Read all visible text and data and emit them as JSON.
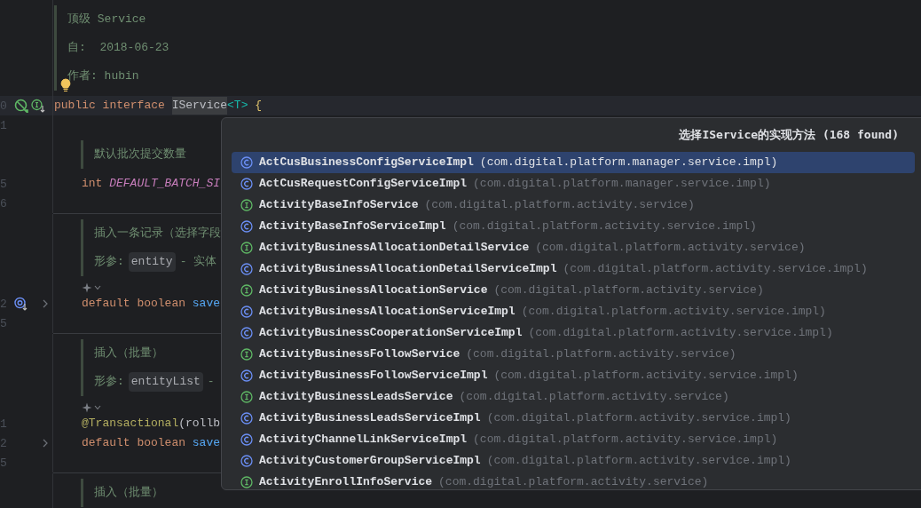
{
  "editor": {
    "rows": [
      {
        "kind": "doc",
        "lines": [
          [
            {
              "kind": "plain",
              "text": "顶级 Service"
            }
          ],
          [
            {
              "kind": "plain",
              "text": "自:  2018-06-23"
            }
          ],
          [
            {
              "kind": "plain",
              "text": "作者: hubin"
            }
          ]
        ],
        "lightbulb": true
      },
      {
        "kind": "code",
        "line_number": "0",
        "current": true,
        "gutter": [
          {
            "kind": "prohibited"
          },
          {
            "kind": "interface-down"
          }
        ],
        "words": [
          [
            {
              "kind": "keyword",
              "text": "public",
              "highlighted": false
            }
          ],
          [
            {
              "kind": "keyword",
              "text": "interface",
              "highlighted": false
            }
          ],
          [
            {
              "kind": "plain",
              "text": "IService",
              "highlighted": true
            },
            {
              "kind": "generic",
              "text": "<T>",
              "highlighted": false
            }
          ],
          [
            {
              "kind": "brace",
              "text": "{",
              "highlighted": false
            }
          ]
        ],
        "children": [
          {
            "kind": "blank",
            "line_number": "1"
          },
          {
            "kind": "doc",
            "lines": [
              [
                {
                  "kind": "plain",
                  "text": "默认批次提交数量"
                }
              ]
            ]
          },
          {
            "kind": "code",
            "line_number": "5",
            "current": false,
            "words": [
              [
                {
                  "kind": "keyword",
                  "text": "int"
                }
              ],
              [
                {
                  "kind": "constant",
                  "text": "DEFAULT_BATCH_SI"
                }
              ]
            ]
          },
          {
            "kind": "blank",
            "line_number": "6"
          },
          {
            "kind": "separator"
          },
          {
            "kind": "doc",
            "lines": [
              [
                {
                  "kind": "plain",
                  "text": "插入一条记录（选择字段"
                }
              ],
              [
                {
                  "kind": "plain",
                  "text": "形参:"
                },
                {
                  "kind": "code",
                  "text": "entity"
                },
                {
                  "kind": "plain",
                  "text": "- 实体"
                }
              ]
            ]
          },
          {
            "kind": "hint"
          },
          {
            "kind": "code",
            "line_number": "2",
            "current": false,
            "gutter": [
              {
                "kind": "override-down"
              },
              {
                "kind": "fold"
              }
            ],
            "words": [
              [
                {
                  "kind": "keyword",
                  "text": "default"
                }
              ],
              [
                {
                  "kind": "keyword",
                  "text": "boolean"
                }
              ],
              [
                {
                  "kind": "method",
                  "text": "save"
                }
              ]
            ]
          },
          {
            "kind": "blank",
            "line_number": "5"
          },
          {
            "kind": "separator"
          },
          {
            "kind": "doc",
            "lines": [
              [
                {
                  "kind": "plain",
                  "text": "插入（批量）"
                }
              ],
              [
                {
                  "kind": "plain",
                  "text": "形参:"
                },
                {
                  "kind": "code",
                  "text": "entityList"
                },
                {
                  "kind": "plain",
                  "text": "-"
                }
              ]
            ]
          },
          {
            "kind": "hint"
          },
          {
            "kind": "code",
            "line_number": "1",
            "current": false,
            "words": [
              [
                {
                  "kind": "annotation",
                  "text": "@Transactional"
                },
                {
                  "kind": "plain",
                  "text": "(rollb"
                }
              ]
            ]
          },
          {
            "kind": "code",
            "line_number": "2",
            "current": false,
            "gutter": [
              {
                "kind": "fold"
              }
            ],
            "words": [
              [
                {
                  "kind": "keyword",
                  "text": "default"
                }
              ],
              [
                {
                  "kind": "keyword",
                  "text": "boolean"
                }
              ],
              [
                {
                  "kind": "method",
                  "text": "save"
                }
              ]
            ]
          },
          {
            "kind": "blank",
            "line_number": "5"
          },
          {
            "kind": "separator"
          },
          {
            "kind": "doc",
            "lines": [
              [
                {
                  "kind": "plain",
                  "text": "插入（批量）"
                }
              ]
            ]
          }
        ]
      }
    ]
  },
  "popup": {
    "title": "选择IService的实现方法 (168 found)",
    "items": [
      {
        "kind": "class",
        "name": "ActCusBusinessConfigServiceImpl",
        "package": "(com.digital.platform.manager.service.impl)",
        "selected": true
      },
      {
        "kind": "class",
        "name": "ActCusRequestConfigServiceImpl",
        "package": "(com.digital.platform.manager.service.impl)",
        "selected": false
      },
      {
        "kind": "interface",
        "name": "ActivityBaseInfoService",
        "package": "(com.digital.platform.activity.service)",
        "selected": false
      },
      {
        "kind": "class",
        "name": "ActivityBaseInfoServiceImpl",
        "package": "(com.digital.platform.activity.service.impl)",
        "selected": false
      },
      {
        "kind": "interface",
        "name": "ActivityBusinessAllocationDetailService",
        "package": "(com.digital.platform.activity.service)",
        "selected": false
      },
      {
        "kind": "class",
        "name": "ActivityBusinessAllocationDetailServiceImpl",
        "package": "(com.digital.platform.activity.service.impl)",
        "selected": false
      },
      {
        "kind": "interface",
        "name": "ActivityBusinessAllocationService",
        "package": "(com.digital.platform.activity.service)",
        "selected": false
      },
      {
        "kind": "class",
        "name": "ActivityBusinessAllocationServiceImpl",
        "package": "(com.digital.platform.activity.service.impl)",
        "selected": false
      },
      {
        "kind": "class",
        "name": "ActivityBusinessCooperationServiceImpl",
        "package": "(com.digital.platform.activity.service.impl)",
        "selected": false
      },
      {
        "kind": "interface",
        "name": "ActivityBusinessFollowService",
        "package": "(com.digital.platform.activity.service)",
        "selected": false
      },
      {
        "kind": "class",
        "name": "ActivityBusinessFollowServiceImpl",
        "package": "(com.digital.platform.activity.service.impl)",
        "selected": false
      },
      {
        "kind": "interface",
        "name": "ActivityBusinessLeadsService",
        "package": "(com.digital.platform.activity.service)",
        "selected": false
      },
      {
        "kind": "class",
        "name": "ActivityBusinessLeadsServiceImpl",
        "package": "(com.digital.platform.activity.service.impl)",
        "selected": false
      },
      {
        "kind": "class",
        "name": "ActivityChannelLinkServiceImpl",
        "package": "(com.digital.platform.activity.service.impl)",
        "selected": false
      },
      {
        "kind": "class",
        "name": "ActivityCustomerGroupServiceImpl",
        "package": "(com.digital.platform.activity.service.impl)",
        "selected": false
      },
      {
        "kind": "interface",
        "name": "ActivityEnrollInfoService",
        "package": "(com.digital.platform.activity.service)",
        "selected": false
      }
    ]
  }
}
